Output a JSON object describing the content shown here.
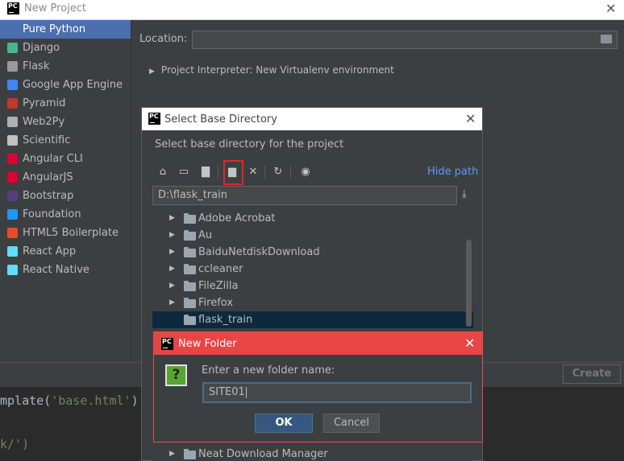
{
  "window": {
    "title": "New Project",
    "close_glyph": "✕",
    "logo_text": "PC"
  },
  "sidebar": {
    "items": [
      {
        "label": "Pure Python",
        "icon": "python-icon",
        "color": "#4b6eaf",
        "selected": true
      },
      {
        "label": "Django",
        "icon": "django-icon",
        "color": "#44b78b"
      },
      {
        "label": "Flask",
        "icon": "flask-icon",
        "color": "#9a9a9a"
      },
      {
        "label": "Google App Engine",
        "icon": "google-app-engine-icon",
        "color": "#4285f4"
      },
      {
        "label": "Pyramid",
        "icon": "pyramid-icon",
        "color": "#c0392b"
      },
      {
        "label": "Web2Py",
        "icon": "web2py-icon",
        "color": "#b0b0b0"
      },
      {
        "label": "Scientific",
        "icon": "scientific-icon",
        "color": "#c0c0c0"
      },
      {
        "label": "Angular CLI",
        "icon": "angular-icon",
        "color": "#dd0031"
      },
      {
        "label": "AngularJS",
        "icon": "angularjs-icon",
        "color": "#dd0031"
      },
      {
        "label": "Bootstrap",
        "icon": "bootstrap-icon",
        "color": "#563d7c"
      },
      {
        "label": "Foundation",
        "icon": "foundation-icon",
        "color": "#2196f3"
      },
      {
        "label": "HTML5 Boilerplate",
        "icon": "html5-icon",
        "color": "#e44d26"
      },
      {
        "label": "React App",
        "icon": "react-icon",
        "color": "#61dafb"
      },
      {
        "label": "React Native",
        "icon": "react-native-icon",
        "color": "#61dafb"
      }
    ]
  },
  "location": {
    "label": "Location:",
    "value": ""
  },
  "interpreter": {
    "label": "Project Interpreter: New Virtualenv environment"
  },
  "footer": {
    "create_label": "Create"
  },
  "editor": {
    "line1_prefix": "mplate(",
    "line1_string": "'base.html'",
    "line1_suffix": ")",
    "line2_string": "k/')"
  },
  "select_dialog": {
    "title": "Select Base Directory",
    "description": "Select base directory for the project",
    "hide_path": "Hide path",
    "path": "D:\\flask_train",
    "tree": [
      {
        "name": "Adobe Acrobat",
        "expandable": true
      },
      {
        "name": "Au",
        "expandable": true
      },
      {
        "name": "BaiduNetdiskDownload",
        "expandable": true
      },
      {
        "name": "ccleaner",
        "expandable": true
      },
      {
        "name": "FileZilla",
        "expandable": true
      },
      {
        "name": "Firefox",
        "expandable": true
      },
      {
        "name": "flask_train",
        "expandable": false,
        "selected": true
      }
    ],
    "tree_bottom": {
      "name": "Neat Download Manager",
      "expandable": true
    }
  },
  "new_folder_dialog": {
    "title": "New Folder",
    "prompt": "Enter a new folder name:",
    "input_value": "SITE01",
    "ok_label": "OK",
    "cancel_label": "Cancel",
    "question_glyph": "?"
  },
  "colors": {
    "accent": "#4b6eaf",
    "link": "#589df6",
    "danger": "#e84545",
    "selection": "#0d293e"
  }
}
